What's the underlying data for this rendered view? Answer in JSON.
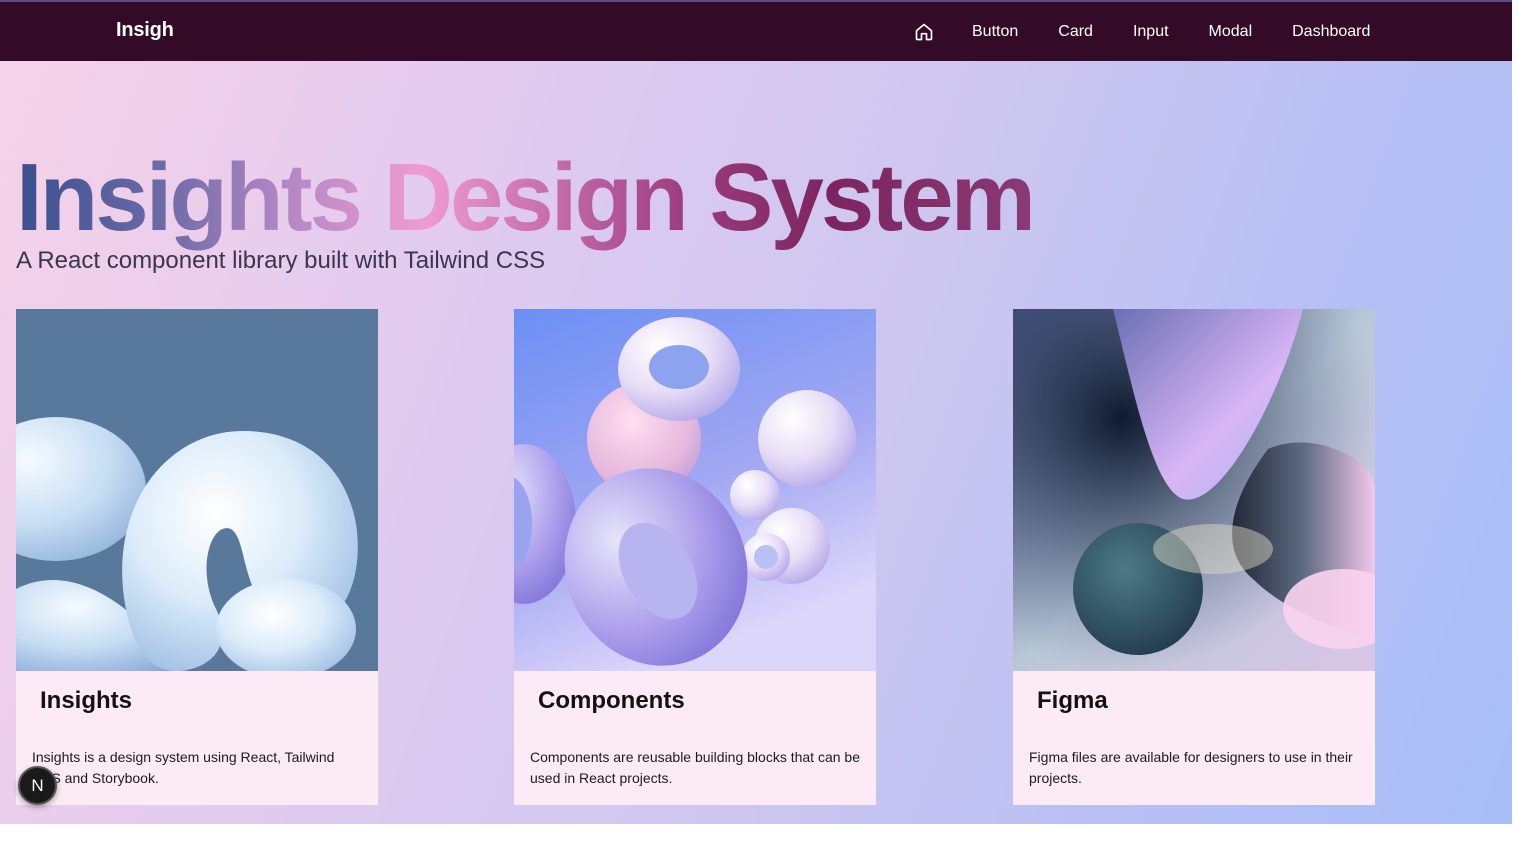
{
  "nav": {
    "brand": "Insigh",
    "home_icon": "home-icon",
    "links": [
      "Button",
      "Card",
      "Input",
      "Modal",
      "Dashboard"
    ]
  },
  "hero": {
    "title": "Insights Design System",
    "subtitle": "A React component library built with Tailwind CSS"
  },
  "cards": [
    {
      "title": "Insights",
      "text": "Insights is a design system using React, Tailwind CSS and Storybook.",
      "image": "blue-3d-blob-shape"
    },
    {
      "title": "Components",
      "text": "Components are reusable building blocks that can be used in React projects.",
      "image": "purple-3d-rings-and-spheres"
    },
    {
      "title": "Figma",
      "text": "Figma files are available for designers to use in their projects.",
      "image": "abstract-pastel-3d-shapes"
    }
  ],
  "badge": {
    "label": "N"
  },
  "colors": {
    "navbar": "#330b26",
    "card_background": "#fcebf5",
    "title_gradient_start": "#3b4f8e",
    "title_gradient_mid": "#ef9cd0",
    "title_gradient_end": "#7d2460"
  }
}
